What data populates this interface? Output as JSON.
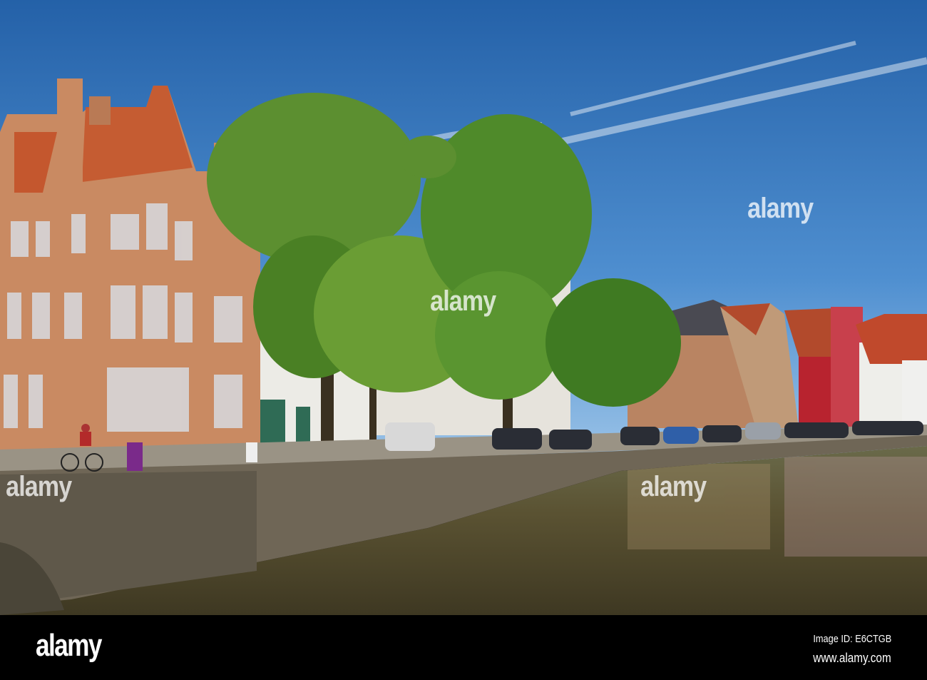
{
  "watermark": {
    "text": "alamy"
  },
  "footer": {
    "logo": "alamy",
    "image_id": "Image ID: E6CTGB",
    "url": "www.alamy.com"
  },
  "colors": {
    "sky_top": "#2461a8",
    "sky_bottom": "#8bb9e4",
    "brick": "#c98a62",
    "roof": "#c4572e",
    "tree": "#4f8a2a",
    "water": "#5a5232",
    "wall": "#6f6656"
  }
}
